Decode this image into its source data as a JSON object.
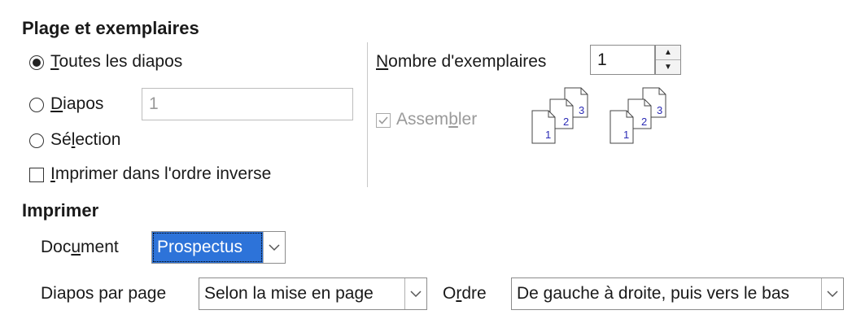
{
  "range": {
    "title": "Plage et exemplaires",
    "all_slides": {
      "pre": "",
      "u": "T",
      "post": "outes les diapos"
    },
    "slides": {
      "pre": "",
      "u": "D",
      "post": "iapos"
    },
    "slides_value": "1",
    "selection": {
      "pre": "Sé",
      "u": "l",
      "post": "ection"
    },
    "reverse": {
      "pre": "",
      "u": "I",
      "post": "mprimer dans l'ordre inverse"
    },
    "selected": "all_slides",
    "reverse_checked": false
  },
  "copies": {
    "label": {
      "pre": "",
      "u": "N",
      "post": "ombre d'exemplaires"
    },
    "value": "1",
    "collate": {
      "pre": "Assem",
      "u": "b",
      "post": "ler"
    },
    "collate_checked": true,
    "page_numbers": [
      "1",
      "2",
      "3"
    ]
  },
  "print": {
    "title": "Imprimer",
    "document_label": {
      "pre": "Doc",
      "u": "u",
      "post": "ment"
    },
    "document_value": "Prospectus",
    "per_page_label": {
      "pre": "Diapos par pa",
      "u": "g",
      "post": "e"
    },
    "per_page_value": "Selon la mise en page",
    "order_label": {
      "pre": "O",
      "u": "r",
      "post": "dre"
    },
    "order_value": "De gauche à droite, puis vers le bas"
  },
  "colors": {
    "accent": "#2d73d9",
    "page_digit": "#2b2bb5"
  }
}
